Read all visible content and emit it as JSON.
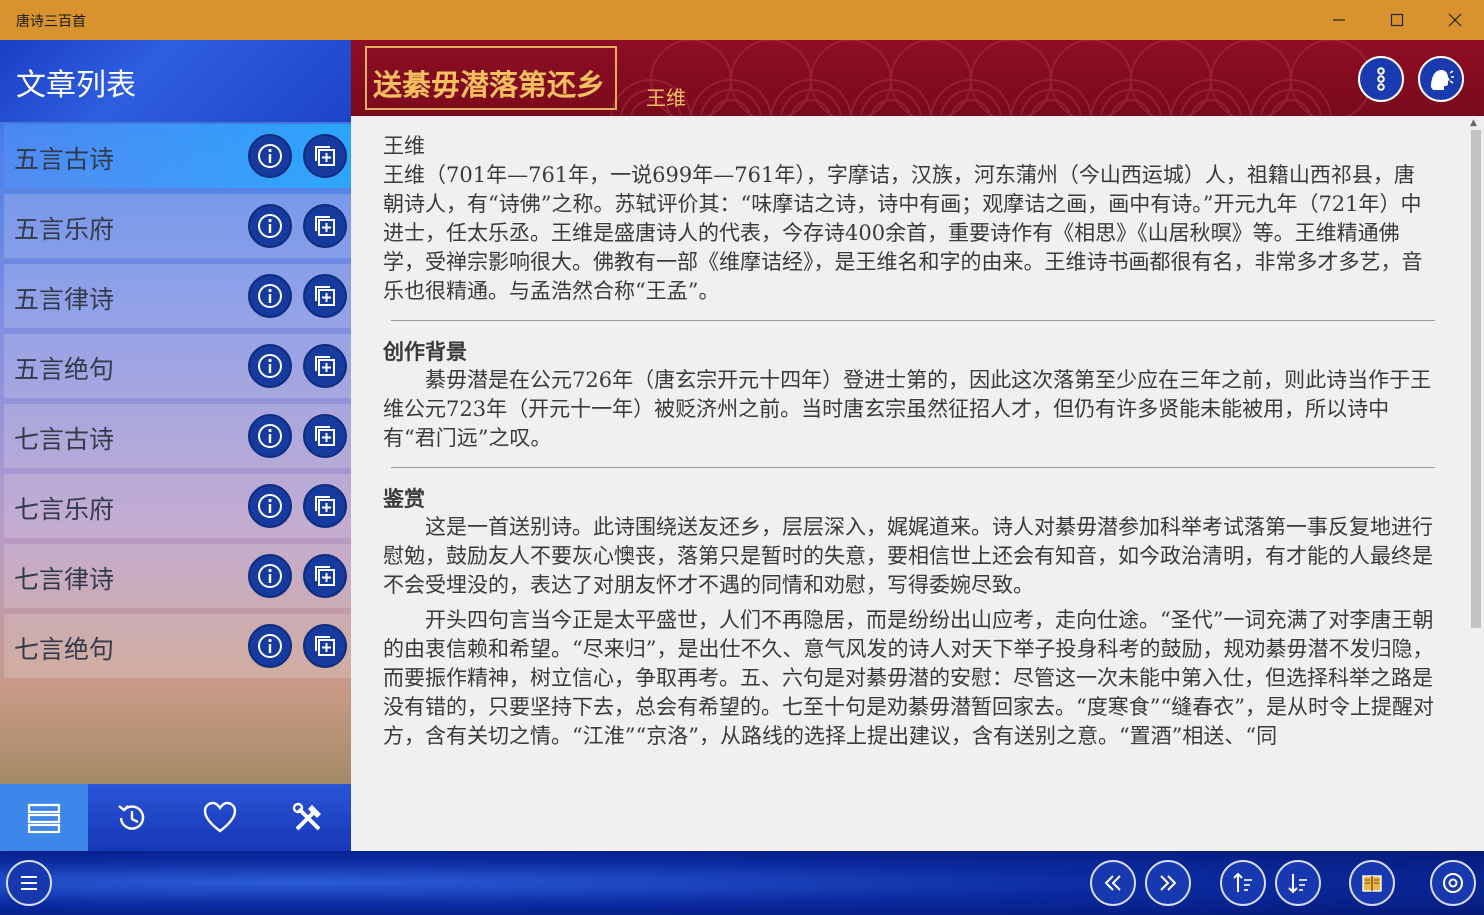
{
  "window": {
    "title": "唐诗三百首",
    "minimize_icon": "minimize-icon",
    "maximize_icon": "maximize-icon",
    "close_icon": "close-icon"
  },
  "sidebar": {
    "title": "文章列表",
    "items": [
      {
        "label": "五言古诗"
      },
      {
        "label": "五言乐府"
      },
      {
        "label": "五言律诗"
      },
      {
        "label": "五言绝句"
      },
      {
        "label": "七言古诗"
      },
      {
        "label": "七言乐府"
      },
      {
        "label": "七言律诗"
      },
      {
        "label": "七言绝句"
      }
    ],
    "bottom_tabs": [
      {
        "icon": "list-icon",
        "active": true
      },
      {
        "icon": "history-icon",
        "active": false
      },
      {
        "icon": "heart-icon",
        "active": false
      },
      {
        "icon": "tools-icon",
        "active": false
      }
    ]
  },
  "poem": {
    "title": "送綦毋潜落第还乡",
    "author": "王维"
  },
  "content": {
    "author_heading": "王维",
    "author_bio": "王维（701年—761年，一说699年—761年），字摩诘，汉族，河东蒲州（今山西运城）人，祖籍山西祁县，唐朝诗人，有“诗佛”之称。苏轼评价其：“味摩诘之诗，诗中有画；观摩诘之画，画中有诗。”开元九年（721年）中进士，任太乐丞。王维是盛唐诗人的代表，今存诗400余首，重要诗作有《相思》《山居秋暝》等。王维精通佛学，受禅宗影响很大。佛教有一部《维摩诘经》，是王维名和字的由来。王维诗书画都很有名，非常多才多艺，音乐也很精通。与孟浩然合称“王孟”。",
    "background_heading": "创作背景",
    "background_text": "綦毋潜是在公元726年（唐玄宗开元十四年）登进士第的，因此这次落第至少应在三年之前，则此诗当作于王维公元723年（开元十一年）被贬济州之前。当时唐玄宗虽然征招人才，但仍有许多贤能未能被用，所以诗中有“君门远”之叹。",
    "appreciation_heading": "鉴赏",
    "appreciation_p1": "这是一首送别诗。此诗围绕送友还乡，层层深入，娓娓道来。诗人对綦毋潜参加科举考试落第一事反复地进行慰勉，鼓励友人不要灰心懊丧，落第只是暂时的失意，要相信世上还会有知音，如今政治清明，有才能的人最终是不会受埋没的，表达了对朋友怀才不遇的同情和劝慰，写得委婉尽致。",
    "appreciation_p2": "开头四句言当今正是太平盛世，人们不再隐居，而是纷纷出山应考，走向仕途。“圣代”一词充满了对李唐王朝的由衷信赖和希望。“尽来归”，是出仕不久、意气风发的诗人对天下举子投身科考的鼓励，规劝綦毋潜不发归隐，而要振作精神，树立信心，争取再考。五、六句是对綦毋潜的安慰：尽管这一次未能中第入仕，但选择科举之路是没有错的，只要坚持下去，总会有希望的。七至十句是劝綦毋潜暂回家去。“度寒食”“缝春衣”，是从时令上提醒对方，含有关切之情。“江淮”“京洛”，从路线的选择上提出建议，含有送别之意。“置酒”相送、“同"
  },
  "appbar": {
    "buttons": [
      "menu-icon",
      "previous-icon",
      "next-icon",
      "sort-ascending-icon",
      "sort-descending-icon",
      "book-icon",
      "settings-icon"
    ]
  },
  "colors": {
    "titlebar": "#d8922e",
    "header_red": "#8e0e24",
    "title_gold": "#f6c060",
    "sidebar_blue": "#1f4bd0",
    "button_blue": "#173a9e"
  }
}
